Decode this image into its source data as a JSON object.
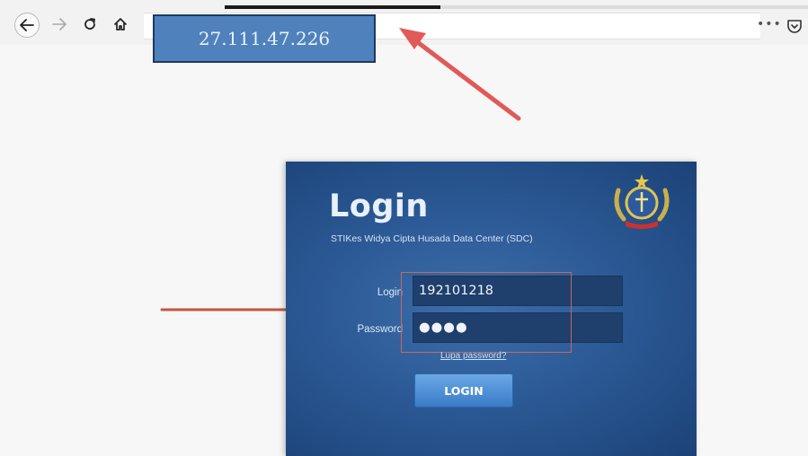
{
  "browser": {
    "loading_progress": 0.37,
    "icons": {
      "back": "back-arrow-icon",
      "forward": "forward-arrow-icon",
      "reload": "reload-icon",
      "home": "home-icon",
      "menu": "more-dots-icon",
      "pocket": "pocket-icon"
    },
    "menu_dots": "•••"
  },
  "annotation": {
    "ip_address": "27.111.47.226",
    "box_color": "#4f81bd",
    "arrow_color": "#e05a57"
  },
  "login": {
    "title": "Login",
    "subtitle": "STIKes Widya Cipta Husada Data Center (SDC)",
    "username_label": "Login",
    "username_value": "192101218",
    "password_label": "Password",
    "password_value": "●●●●",
    "forgot_link": "Lupa password?",
    "button_label": "LOGIN",
    "emblem": "institution-emblem-icon"
  }
}
